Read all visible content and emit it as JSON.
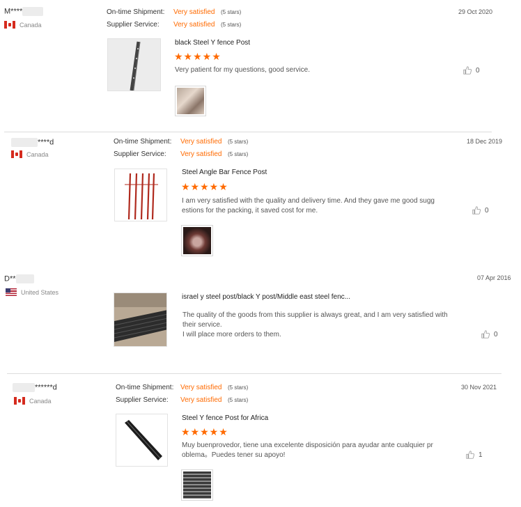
{
  "reviews": [
    {
      "user": "M****",
      "country": "Canada",
      "flag": "ca",
      "date": "29 Oct 2020",
      "shipment_label": "On-time Shipment:",
      "shipment_value": "Very satisfied",
      "shipment_count": "(5 stars)",
      "service_label": "Supplier Service:",
      "service_value": "Very satisfied",
      "service_count": "(5 stars)",
      "product": "black Steel Y fence Post",
      "stars": "★★★★★",
      "comment": "Very patient for my questions, good service.",
      "likes": "0"
    },
    {
      "user": "****d",
      "country": "Canada",
      "flag": "ca",
      "date": "18 Dec 2019",
      "shipment_label": "On-time Shipment:",
      "shipment_value": "Very satisfied",
      "shipment_count": "(5 stars)",
      "service_label": "Supplier Service:",
      "service_value": "Very satisfied",
      "service_count": "(5 stars)",
      "product": "Steel Angle Bar Fence Post",
      "stars": "★★★★★",
      "comment": "I am very satisfied with the quality and delivery time. And they gave me good sugg estions for the packing, it saved cost for me.",
      "likes": "0"
    },
    {
      "user": "D**",
      "country": "United States",
      "flag": "us",
      "date": "07 Apr 2016",
      "product": "israel y steel post/black Y post/Middle east steel fenc...",
      "comment": "The quality of the goods from this supplier is always great, and I am very satisfied with their service.",
      "comment2": "I will place more orders to them.",
      "likes": "0"
    },
    {
      "user": "******d",
      "country": "Canada",
      "flag": "ca",
      "date": "30 Nov 2021",
      "shipment_label": "On-time Shipment:",
      "shipment_value": "Very satisfied",
      "shipment_count": "(5 stars)",
      "service_label": "Supplier Service:",
      "service_value": "Very satisfied",
      "service_count": "(5 stars)",
      "product": "Steel Y fence Post for Africa",
      "stars": "★★★★★",
      "comment": "Muy buenprovedor, tiene una excelente disposición para ayudar ante cualquier pr oblema。Puedes tener su apoyo!",
      "likes": "1"
    }
  ],
  "colors": {
    "accent": "#ff6a00",
    "separator": "#dcdcdc"
  }
}
